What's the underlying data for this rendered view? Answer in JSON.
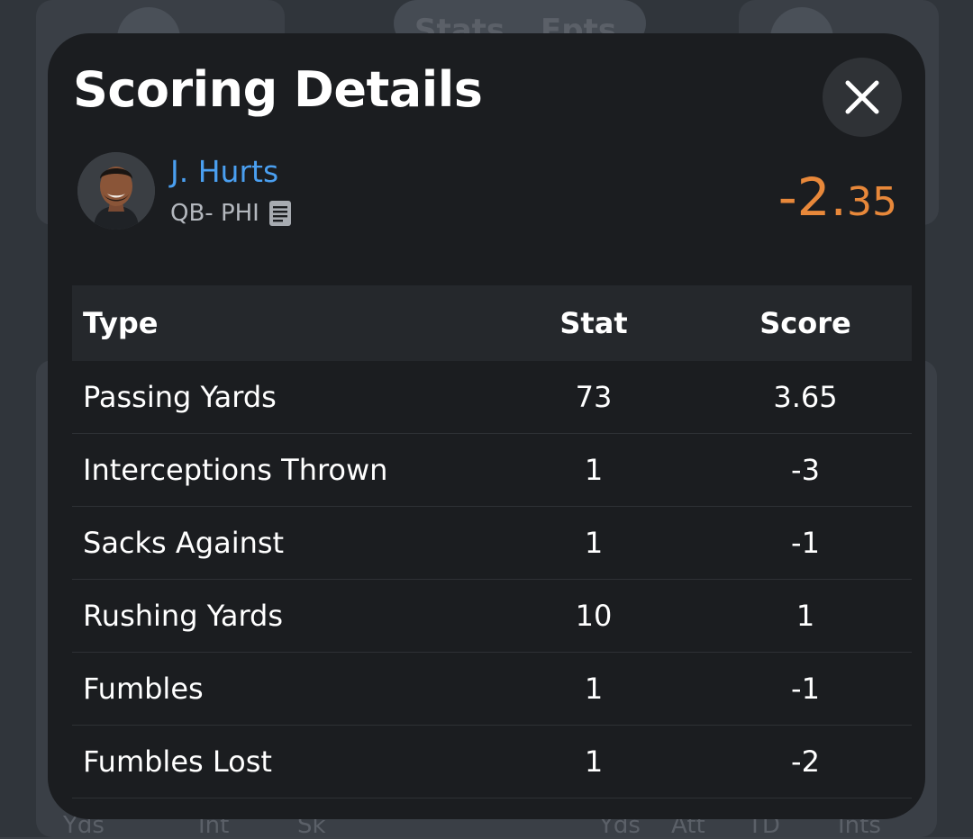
{
  "background": {
    "tabs": [
      "Stats",
      "Fpts"
    ],
    "bottom_texts": [
      "Yds",
      "Int",
      "Sk",
      "Yds",
      "Att",
      "TD",
      "Ints"
    ]
  },
  "modal": {
    "title": "Scoring Details",
    "close_icon": "close-icon"
  },
  "player": {
    "name": "J. Hurts",
    "position_team": "QB- PHI",
    "note_icon": "note-icon",
    "total_main": "-2.",
    "total_decimal": "35"
  },
  "table": {
    "headers": {
      "type": "Type",
      "stat": "Stat",
      "score": "Score"
    },
    "rows": [
      {
        "type": "Passing Yards",
        "stat": "73",
        "score": "3.65"
      },
      {
        "type": "Interceptions Thrown",
        "stat": "1",
        "score": "-3"
      },
      {
        "type": "Sacks Against",
        "stat": "1",
        "score": "-1"
      },
      {
        "type": "Rushing Yards",
        "stat": "10",
        "score": "1"
      },
      {
        "type": "Fumbles",
        "stat": "1",
        "score": "-1"
      },
      {
        "type": "Fumbles Lost",
        "stat": "1",
        "score": "-2"
      }
    ]
  },
  "colors": {
    "modal_bg": "#1b1d20",
    "header_bg": "#25282c",
    "player_link": "#4a9ff0",
    "total_score": "#e8883a",
    "text": "#ffffff"
  }
}
